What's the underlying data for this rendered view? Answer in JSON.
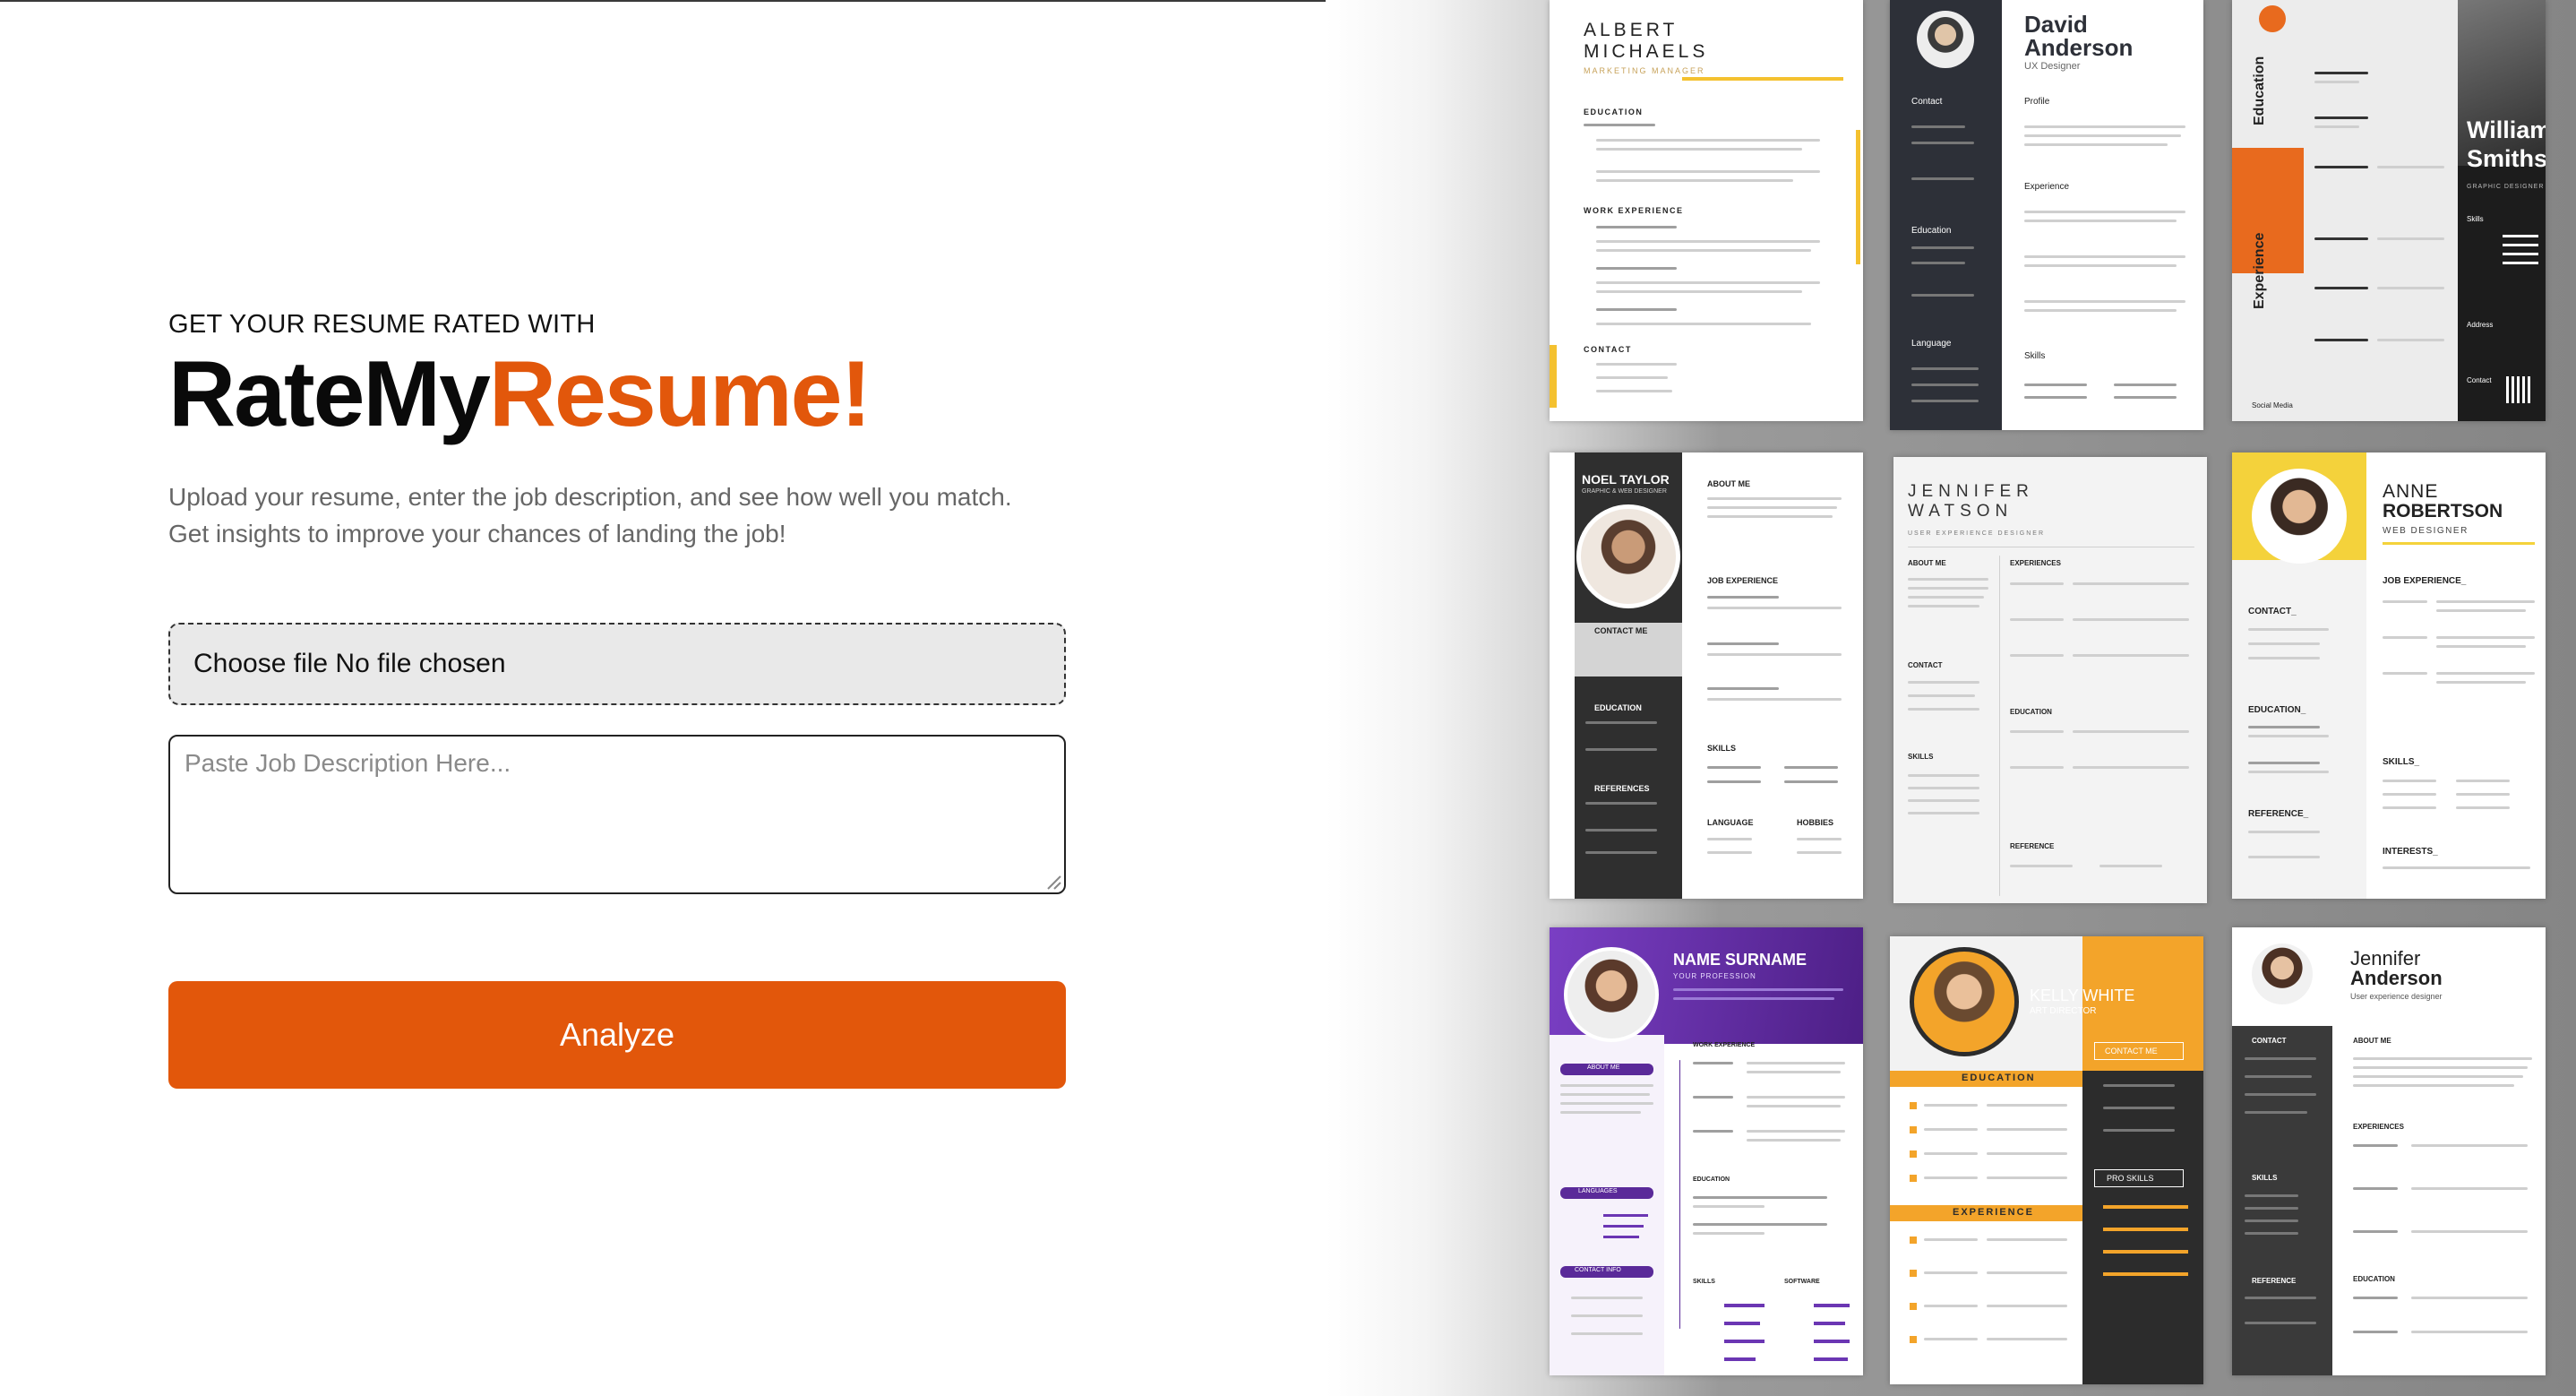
{
  "header": {
    "kicker": "GET YOUR RESUME RATED WITH",
    "brand_part1": "RateMy",
    "brand_part2": "Resume!",
    "accent_color": "#e2570b"
  },
  "description": {
    "line1": "Upload your resume, enter the job description, and see how well you match.",
    "line2": "Get insights to improve your chances of landing the job!"
  },
  "form": {
    "file_input_label": "Choose file No file chosen",
    "job_description_placeholder": "Paste Job Description Here...",
    "job_description_value": "",
    "analyze_label": "Analyze"
  },
  "gallery": {
    "templates": [
      {
        "name_line1": "ALBERT",
        "name_line2": "MICHAELS",
        "role": "MARKETING MANAGER",
        "sections": [
          "EDUCATION",
          "WORK EXPERIENCE",
          "CONTACT"
        ]
      },
      {
        "name_line1": "David",
        "name_line2": "Anderson",
        "role": "UX Designer",
        "sections": [
          "Contact",
          "Education",
          "Language",
          "Profile",
          "Experience",
          "Skills"
        ]
      },
      {
        "name_line1": "Williams",
        "name_line2": "Smiths",
        "role": "GRAPHIC DESIGNER",
        "sections": [
          "Education",
          "Experience",
          "Skills",
          "Address",
          "Contact",
          "Social Media"
        ]
      },
      {
        "name_line1": "NOEL TAYLOR",
        "name_line2": "",
        "role": "GRAPHIC & WEB DESIGNER",
        "sections": [
          "ABOUT ME",
          "JOB EXPERIENCE",
          "CONTACT ME",
          "EDUCATION",
          "REFERENCES",
          "SKILLS",
          "LANGUAGE",
          "HOBBIES"
        ]
      },
      {
        "name_line1": "JENNIFER",
        "name_line2": "WATSON",
        "role": "USER EXPERIENCE DESIGNER",
        "sections": [
          "ABOUT ME",
          "EXPERIENCES",
          "CONTACT",
          "EDUCATION",
          "SKILLS",
          "REFERENCE"
        ]
      },
      {
        "name_line1": "ANNE",
        "name_line2": "ROBERTSON",
        "role": "WEB DESIGNER",
        "sections": [
          "JOB EXPERIENCE_",
          "CONTACT_",
          "EDUCATION_",
          "SKILLS_",
          "REFERENCE_",
          "INTERESTS_"
        ]
      },
      {
        "name_line1": "NAME SURNAME",
        "name_line2": "",
        "role": "YOUR PROFESSION",
        "sections": [
          "ABOUT ME",
          "WORK EXPERIENCE",
          "EDUCATION",
          "LANGUAGES",
          "CONTACT INFO",
          "SKILLS",
          "SOFTWARE"
        ]
      },
      {
        "name_line1": "KELLY WHITE",
        "name_line2": "",
        "role": "ART DIRECTOR",
        "sections": [
          "EDUCATION",
          "EXPERIENCE",
          "CONTACT ME",
          "PRO SKILLS"
        ]
      },
      {
        "name_line1": "Jennifer",
        "name_line2": "Anderson",
        "role": "User experience designer",
        "sections": [
          "CONTACT",
          "ABOUT ME",
          "EXPERIENCES",
          "SKILLS",
          "REFERENCE",
          "EDUCATION"
        ]
      }
    ]
  }
}
